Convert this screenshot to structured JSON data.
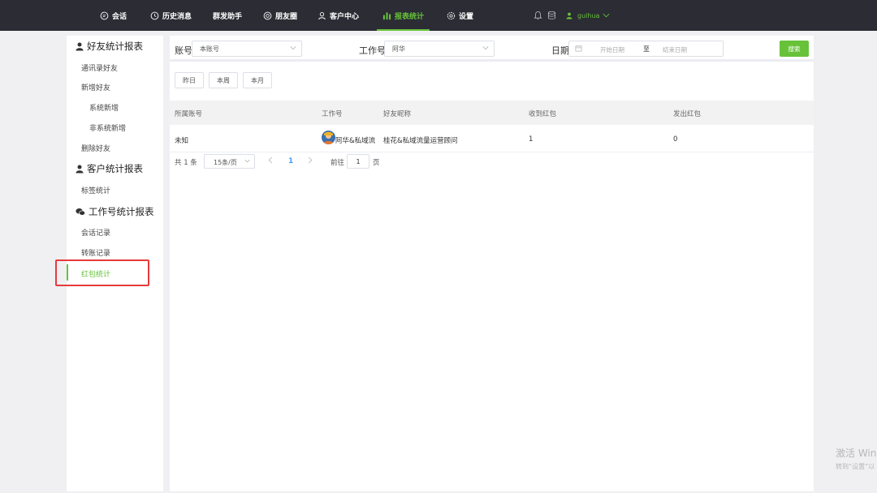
{
  "nav": {
    "items": [
      {
        "label": "会话",
        "icon": "chat-icon"
      },
      {
        "label": "历史消息",
        "icon": "clock-icon"
      },
      {
        "label": "群发助手",
        "icon": ""
      },
      {
        "label": "朋友圈",
        "icon": "moments-icon"
      },
      {
        "label": "客户中心",
        "icon": "user-icon"
      },
      {
        "label": "报表统计",
        "icon": "bar-chart-icon"
      },
      {
        "label": "设置",
        "icon": "gear-icon"
      }
    ],
    "active": "报表统计",
    "user": "guihua",
    "accent_color": "#67c23a",
    "bg_color": "#2b2c34"
  },
  "sidebar": {
    "groups": [
      {
        "title": "好友统计报表",
        "icon": "user-icon",
        "items": [
          "通讯录好友",
          "新增好友",
          "系统新增",
          "非系统新增",
          "删除好友"
        ]
      },
      {
        "title": "客户统计报表",
        "icon": "user-icon",
        "items": [
          "标签统计"
        ]
      },
      {
        "title": "工作号统计报表",
        "icon": "wechat-icon",
        "items": [
          "会话记录",
          "转账记录",
          "红包统计"
        ]
      }
    ],
    "active_item": "红包统计"
  },
  "filters": {
    "account_label": "账号",
    "account_value": "本账号",
    "work_label": "工作号",
    "work_value": "阿华",
    "date_label": "日期",
    "date_start_placeholder": "开始日期",
    "date_sep": "至",
    "date_end_placeholder": "结束日期",
    "search_button": "搜索"
  },
  "quick_ranges": [
    "昨日",
    "本周",
    "本月"
  ],
  "table": {
    "headers": [
      "所属账号",
      "工作号",
      "好友昵称",
      "收到红包",
      "发出红包"
    ],
    "rows": [
      {
        "account": "未知",
        "work_no": "阿华&私域流",
        "friend_nickname": "桂花&私域流量运营顾问",
        "received": "1",
        "sent": "0"
      }
    ]
  },
  "pagination": {
    "total_text": "共 1 条",
    "page_size": "15条/页",
    "current_page": "1",
    "goto_label": "前往",
    "goto_value": "1",
    "page_unit": "页"
  },
  "watermark": {
    "line1": "激活 Win",
    "line2": "转到“设置”以"
  }
}
